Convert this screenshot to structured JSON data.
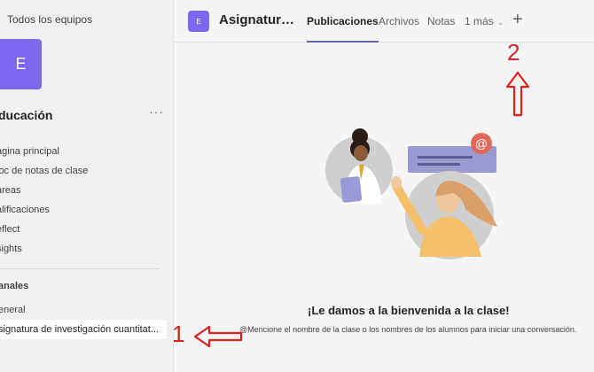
{
  "sidebar": {
    "back_label": "Todos los equipos",
    "team_avatar_letter": "E",
    "team_name": "ducación",
    "more_label": "···",
    "nav_items": [
      {
        "label": "ágina principal"
      },
      {
        "label": "loc de notas de clase"
      },
      {
        "label": "areas"
      },
      {
        "label": "alificaciones"
      },
      {
        "label": "eflect"
      },
      {
        "label": "sights"
      }
    ],
    "channels_label": "anales",
    "channels": [
      {
        "label": "eneral"
      },
      {
        "label": "signatura de investigación cuantitat..."
      }
    ]
  },
  "header": {
    "avatar_letter": "E",
    "title": "Asignatura...",
    "tabs": [
      {
        "label": "Publicaciones",
        "active": true
      },
      {
        "label": "Archivos"
      },
      {
        "label": "Notas"
      },
      {
        "label": "1 más"
      }
    ],
    "add_label": "+"
  },
  "main": {
    "welcome_title": "¡Le damos a la bienvenida a la clase!",
    "welcome_subtitle": "@Mencione el nombre de la clase o los nombres de los alumnos para iniciar una conversación."
  },
  "annotations": {
    "label_1": "1",
    "label_2": "2"
  },
  "colors": {
    "accent": "#6264a7",
    "team_avatar": "#7b68ee",
    "annotation": "#e02020"
  }
}
